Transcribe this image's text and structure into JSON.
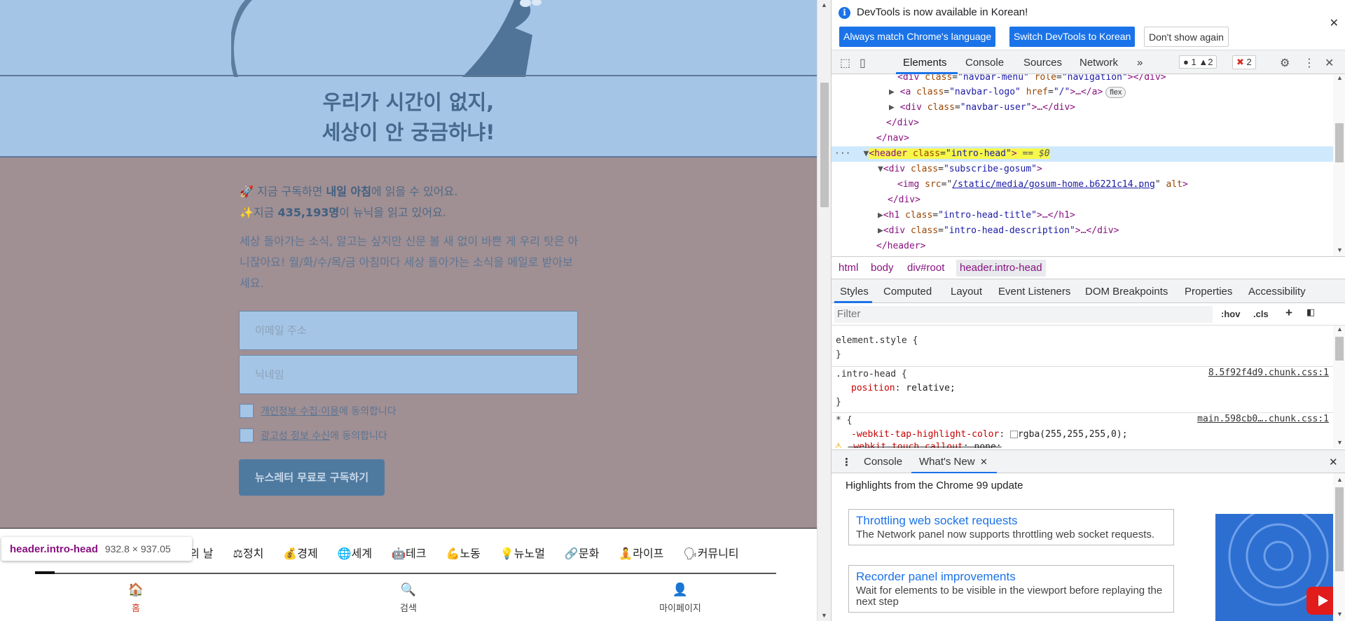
{
  "page": {
    "hero_title_line1": "우리가 시간이 없지,",
    "hero_title_line2": "세상이 안 궁금하냐!",
    "info1_prefix": "🚀 지금 구독하면 ",
    "info1_bold": "내일 아침",
    "info1_suffix": "에 읽을 수 있어요.",
    "info2_prefix": "✨지금 ",
    "info2_bold": "435,193명",
    "info2_suffix": "이 뉴닉을 읽고 있어요.",
    "description": "세상 돌아가는 소식, 알고는 싶지만 신문 볼 새 없이 바쁜 게 우리 탓은 아니잖아요! 월/화/수/목/금 아침마다 세상 돌아가는 소식을 메일로 받아보세요.",
    "email_placeholder": "이메일 주소",
    "nickname_placeholder": "닉네임",
    "privacy_link": "개인정보 수집·이용",
    "privacy_suffix": "에 동의합니다",
    "ad_link": "광고성 정보 수신",
    "ad_suffix": "에 동의합니다",
    "subscribe_label": "뉴스레터 무료로 구독하기",
    "categories": [
      {
        "icon": "",
        "label": "의 날"
      },
      {
        "icon": "⚖",
        "label": "정치"
      },
      {
        "icon": "💰",
        "label": "경제"
      },
      {
        "icon": "🌐",
        "label": "세계"
      },
      {
        "icon": "🤖",
        "label": "테크"
      },
      {
        "icon": "💪",
        "label": "노동"
      },
      {
        "icon": "💡",
        "label": "뉴노멀"
      },
      {
        "icon": "🔗",
        "label": "문화"
      },
      {
        "icon": "🧘",
        "label": "라이프"
      },
      {
        "icon": "🗣",
        "label": "커뮤니티"
      }
    ],
    "tooltip_name": "header.intro-head",
    "tooltip_size": "932.8 × 937.05",
    "bottom_nav": [
      {
        "icon": "🏠",
        "label": "홈"
      },
      {
        "icon": "🔍",
        "label": "검색"
      },
      {
        "icon": "👤",
        "label": "마이페이지"
      }
    ]
  },
  "devtools": {
    "info_message": "DevTools is now available in Korean!",
    "btn_match": "Always match Chrome's language",
    "btn_switch": "Switch DevTools to Korean",
    "btn_dont_show": "Don't show again",
    "tabs": [
      "Elements",
      "Console",
      "Sources",
      "Network"
    ],
    "more_tabs": "»",
    "counts": {
      "info": "1",
      "warn": "2",
      "error": "2"
    },
    "dom_lines": {
      "l1_tag_open": "<div ",
      "l1_attr1": "class",
      "l1_val1": "\"navbar-menu\"",
      "l1_attr2": "role",
      "l1_val2": "\"navigation\"",
      "l1_tag_close": "></div>",
      "l2_tag_open": "<a ",
      "l2_attr1": "class",
      "l2_val1": "\"navbar-logo\"",
      "l2_attr2": "href",
      "l2_val2": "\"/\"",
      "l2_tag_close": ">…</a>",
      "l2_badge": "flex",
      "l3_tag_open": "<div ",
      "l3_attr1": "class",
      "l3_val1": "\"navbar-user\"",
      "l3_tag_close": ">…</div>",
      "l4": "</div>",
      "l5": "</nav>",
      "l6_tag_open": "<header ",
      "l6_attr1": "class",
      "l6_val1": "\"intro-head\"",
      "l6_tag_close": ">",
      "l6_eq": " == $0",
      "l7_tag_open": "<div ",
      "l7_attr1": "class",
      "l7_val1": "\"subscribe-gosum\"",
      "l7_tag_close": ">",
      "l8_tag_open": "<img ",
      "l8_attr1": "src",
      "l8_val1": "/static/media/gosum-home.b6221c14.png",
      "l8_attr2": " alt",
      "l8_tag_close": ">",
      "l9": "</div>",
      "l10_tag_open": "<h1 ",
      "l10_attr1": "class",
      "l10_val1": "\"intro-head-title\"",
      "l10_tag_close": ">…</h1>",
      "l11_tag_open": "<div ",
      "l11_attr1": "class",
      "l11_val1": "\"intro-head-description\"",
      "l11_tag_close": ">…</div>",
      "l12": "</header>"
    },
    "breadcrumbs": [
      "html",
      "body",
      "div#root",
      "header.intro-head"
    ],
    "style_tabs": [
      "Styles",
      "Computed",
      "Layout",
      "Event Listeners",
      "DOM Breakpoints",
      "Properties",
      "Accessibility"
    ],
    "filter_placeholder": "Filter",
    "hov": ":hov",
    "cls": ".cls",
    "styles": {
      "element_style": "element.style {",
      "close": "}",
      "rule1_selector": ".intro-head {",
      "rule1_src": "8.5f92f4d9.chunk.css:1",
      "rule1_prop": "position",
      "rule1_val": "relative;",
      "rule2_selector": "* {",
      "rule2_src": "main.598cb0….chunk.css:1",
      "rule2_prop1": "-webkit-tap-highlight-color",
      "rule2_val1": "rgba(255,255,255,0);",
      "rule2_prop2": "-webkit-touch-callout",
      "rule2_val2": "none;"
    },
    "drawer_tabs": [
      "Console",
      "What's New"
    ],
    "whats_new_header": "Highlights from the Chrome 99 update",
    "cards": [
      {
        "title": "Throttling web socket requests",
        "desc": "The Network panel now supports throttling web socket requests."
      },
      {
        "title": "Recorder panel improvements",
        "desc": "Wait for elements to be visible in the viewport before replaying the next step"
      }
    ]
  },
  "colors": {
    "hero_bg": "#a5c5e7",
    "overlay_bg": "#a08f93",
    "accent_blue": "#1a73e8",
    "selected_line": "#cfe8fc"
  }
}
